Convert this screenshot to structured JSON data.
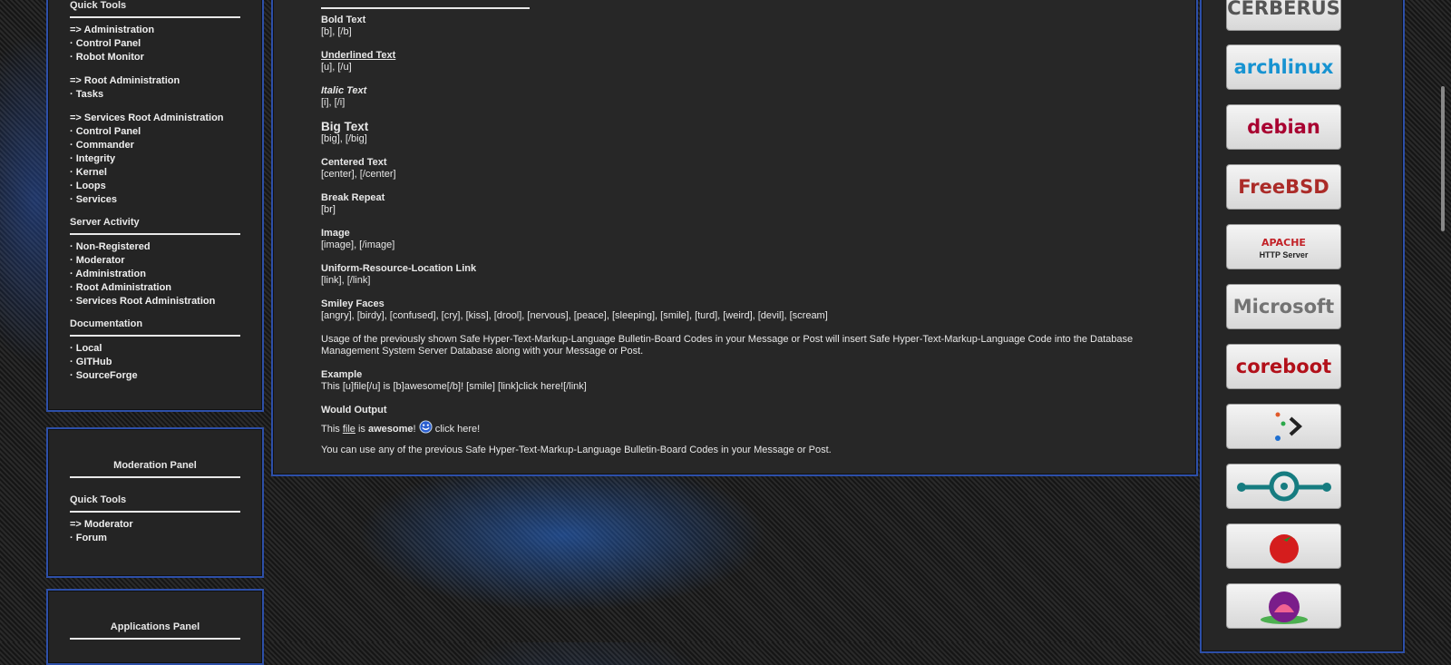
{
  "sidebar": {
    "quick_tools_title": "Quick Tools",
    "admin_links": [
      {
        "label": "=> Administration",
        "root": true
      },
      {
        "label": "· Control Panel"
      },
      {
        "label": "· Robot Monitor"
      },
      {
        "label": "",
        "gap": true
      },
      {
        "label": "=> Root Administration",
        "root": true
      },
      {
        "label": "· Tasks"
      },
      {
        "label": "",
        "gap": true
      },
      {
        "label": "=> Services Root Administration",
        "root": true
      },
      {
        "label": "· Control Panel"
      },
      {
        "label": "· Commander"
      },
      {
        "label": "· Integrity"
      },
      {
        "label": "· Kernel"
      },
      {
        "label": "· Loops"
      },
      {
        "label": "· Services"
      }
    ],
    "server_activity_title": "Server Activity",
    "server_activity_links": [
      "· Non-Registered",
      "· Moderator",
      "· Administration",
      "· Root Administration",
      "· Services Root Administration"
    ],
    "documentation_title": "Documentation",
    "documentation_links": [
      "· Local",
      "· GITHub",
      "· SourceForge"
    ],
    "moderation_panel_title": "Moderation Panel",
    "moderation_quick_tools_title": "Quick Tools",
    "moderation_links": [
      "=> Moderator",
      "· Forum"
    ],
    "applications_panel_title": "Applications Panel"
  },
  "codes": [
    {
      "heading": "Bold Text",
      "code": "[b], [/b]"
    },
    {
      "heading": "Underlined Text",
      "code": "[u], [/u]"
    },
    {
      "heading": "Italic Text",
      "code": "[i], [/i]"
    },
    {
      "heading": "Big Text",
      "code": "[big], [/big]"
    },
    {
      "heading": "Centered Text",
      "code": "[center], [/center]"
    },
    {
      "heading": "Break Repeat",
      "code": "[br]"
    },
    {
      "heading": "Image",
      "code": "[image], [/image]"
    },
    {
      "heading": "Uniform-Resource-Location Link",
      "code": "[link], [/link]"
    },
    {
      "heading": "Smiley Faces",
      "code": "[angry], [birdy], [confused], [cry], [kiss], [drool], [nervous], [peace], [sleeping], [smile], [turd], [weird], [devil], [scream]"
    }
  ],
  "usage_note": "Usage of the previously shown Safe Hyper-Text-Markup-Language Bulletin-Board Codes in your Message or Post will insert Safe Hyper-Text-Markup-Language Code into the Database Management System Server Database along with your Message or Post.",
  "example": {
    "heading": "Example",
    "code": "This [u]file[/u] is [b]awesome[/b]! [smile] [link]click here![/link]"
  },
  "output": {
    "heading": "Would Output",
    "this": "This",
    "file": "file",
    "is": "is",
    "awesome": "awesome",
    "bang": "!",
    "link": "click here!"
  },
  "closing_note": "You can use any of the previous Safe Hyper-Text-Markup-Language Bulletin-Board Codes in your Message or Post.",
  "logos": [
    {
      "name": "cerberus-logo",
      "text": "CERBERUS",
      "color": "#555"
    },
    {
      "name": "archlinux-logo",
      "text": "archlinux",
      "color": "#1793d1"
    },
    {
      "name": "debian-logo",
      "text": "debian",
      "color": "#a80030"
    },
    {
      "name": "freebsd-logo",
      "text": "FreeBSD",
      "color": "#ab2b28"
    },
    {
      "name": "apache-logo",
      "text": "APACHE",
      "sub": "HTTP Server",
      "color": "#c22127"
    },
    {
      "name": "microsoft-logo",
      "text": "Microsoft",
      "color": "#737373"
    },
    {
      "name": "coreboot-logo",
      "text": "coreboot",
      "color": "#b2101a"
    },
    {
      "name": "prompt-logo",
      "text": "",
      "color": "#333"
    },
    {
      "name": "lineageos-logo",
      "text": "",
      "color": "#167c80"
    },
    {
      "name": "tomato-logo",
      "text": "",
      "color": "#d51d1d"
    },
    {
      "name": "lotus-logo",
      "text": "",
      "color": "#7a1d8a"
    }
  ]
}
